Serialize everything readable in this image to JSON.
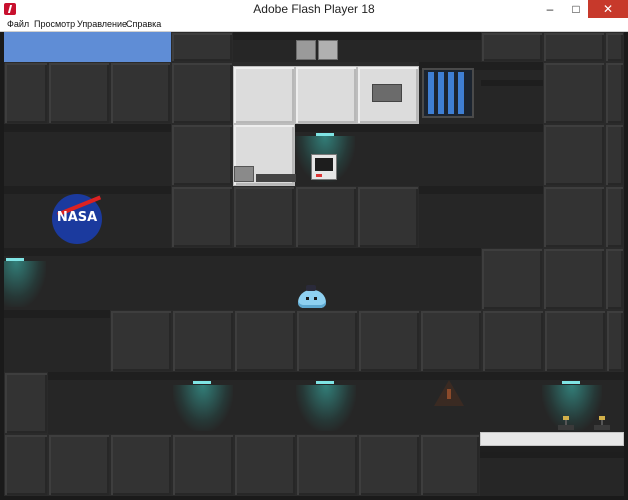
{
  "window": {
    "title": "Adobe Flash Player 18",
    "controls": {
      "minimize": "–",
      "maximize": "□",
      "close": "✕"
    }
  },
  "menu": {
    "items": [
      "Файл",
      "Просмотр",
      "Управление",
      "Справка"
    ]
  },
  "game": {
    "logo_text": "NASA",
    "colors": {
      "sky": "#5f8dd6",
      "lamp": "#7fe4e4",
      "blob": "#8ed0f0",
      "wall": "#333333",
      "panel": "#dcdcdc"
    },
    "icons": [
      "flash-player-icon",
      "nasa-logo-icon",
      "warning-sign-icon",
      "computer-terminal-icon",
      "lever-icon"
    ]
  }
}
